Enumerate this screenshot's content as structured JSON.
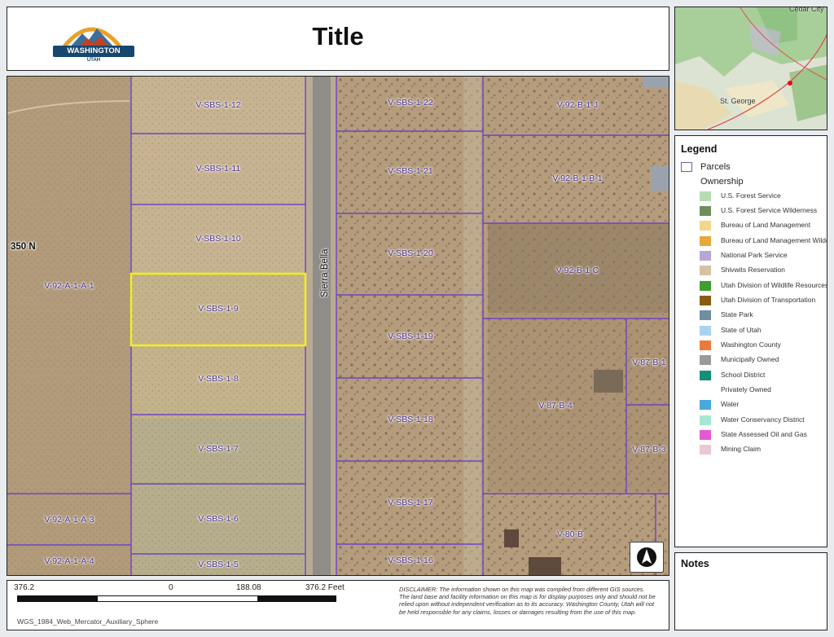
{
  "title": "Title",
  "logo": {
    "name": "WASHINGTON COUNTY",
    "sub": "UTAH"
  },
  "overview": {
    "places": [
      "Cedar City",
      "St. George"
    ]
  },
  "streets": {
    "east_west": "350 N",
    "north_south": "Sierra Bella"
  },
  "parcels": [
    {
      "id": "V-SBS-1-12"
    },
    {
      "id": "V-SBS-1-11"
    },
    {
      "id": "V-SBS-1-10"
    },
    {
      "id": "V-SBS-1-9",
      "highlighted": true
    },
    {
      "id": "V-SBS-1-8"
    },
    {
      "id": "V-SBS-1-7"
    },
    {
      "id": "V-SBS-1-6"
    },
    {
      "id": "V-SBS-1-5"
    },
    {
      "id": "V-SBS-1-22"
    },
    {
      "id": "V-SBS-1-21"
    },
    {
      "id": "V-SBS-1-20"
    },
    {
      "id": "V-SBS-1-19"
    },
    {
      "id": "V-SBS-1-18"
    },
    {
      "id": "V-SBS-1-17"
    },
    {
      "id": "V-SBS-1-16"
    },
    {
      "id": "V-92-B-1-J"
    },
    {
      "id": "V-92-B-1-B-1"
    },
    {
      "id": "V-92-B-1-C"
    },
    {
      "id": "V-87-B-1"
    },
    {
      "id": "V-87-B-4"
    },
    {
      "id": "V-87-B-3"
    },
    {
      "id": "V-80-B"
    },
    {
      "id": "V-92-A-1-A-1"
    },
    {
      "id": "V-92-A-1-A-3"
    },
    {
      "id": "V-92-A-1-A-4"
    }
  ],
  "colors": {
    "parcel_line": "#6b45c4",
    "highlight": "#f2ee1c",
    "label": "#4a2f8a"
  },
  "legend": {
    "title": "Legend",
    "parcels_label": "Parcels",
    "ownership_label": "Ownership",
    "items": [
      {
        "label": "U.S. Forest Service",
        "color": "#b7dcb5"
      },
      {
        "label": "U.S. Forest Service Wilderness",
        "color": "#6f8f5a"
      },
      {
        "label": "Bureau of Land Management",
        "color": "#f1d68e"
      },
      {
        "label": "Bureau of Land Management Wilde",
        "color": "#e6a93a"
      },
      {
        "label": "National Park Service",
        "color": "#b7a6d6"
      },
      {
        "label": "Shivwits Reservation",
        "color": "#d6c2a3"
      },
      {
        "label": "Utah Division of Wildlife Resources",
        "color": "#3f9e2e"
      },
      {
        "label": "Utah Division of Transportation",
        "color": "#8a5a12"
      },
      {
        "label": "State Park",
        "color": "#6f8ea0"
      },
      {
        "label": "State of Utah",
        "color": "#a9d3ee"
      },
      {
        "label": "Washington County",
        "color": "#ec7a3b"
      },
      {
        "label": "Municipally Owned",
        "color": "#9a9a9a"
      },
      {
        "label": "School District",
        "color": "#13907a"
      },
      {
        "label": "Privately Owned",
        "color": "#ffffff"
      },
      {
        "label": "Water",
        "color": "#4aa8e0"
      },
      {
        "label": "Water Conservancy District",
        "color": "#a5e7d4"
      },
      {
        "label": "State Assessed Oil and Gas",
        "color": "#e25ad3"
      },
      {
        "label": "Mining Claim",
        "color": "#ecc7d4"
      }
    ]
  },
  "notes": {
    "title": "Notes"
  },
  "scale": {
    "left": "376.2",
    "zero": "0",
    "mid": "188.08",
    "right": "376.2 Feet"
  },
  "disclaimer": "DISCLAIMER: The information shown on this map was compiled from different GIS sources. The land base and facility information on this map is for display purposes only and should not be relied upon without independent verification as to its accuracy. Washington County, Utah will not be held responsible for any claims, losses or damages resulting from the use of this map.",
  "projection": "WGS_1984_Web_Mercator_Auxiliary_Sphere"
}
